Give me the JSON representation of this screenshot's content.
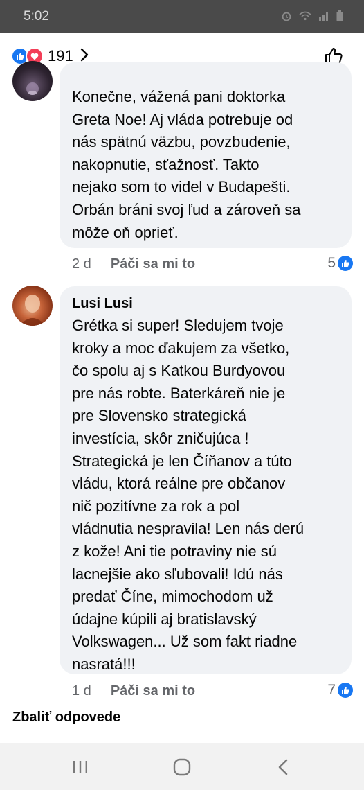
{
  "status_bar": {
    "time": "5:02"
  },
  "header": {
    "reaction_count": "191",
    "icons": [
      "like-reaction-icon",
      "love-reaction-icon",
      "chevron-right-icon",
      "thumbs-up-icon"
    ]
  },
  "comments": [
    {
      "author": "",
      "text": "Konečne, vážená pani doktorka\nGreta Noe! Aj vláda potrebuje od\nnás spätnú väzbu, povzbudenie,\nnakopnutie, sťažnosť. Takto\nnejako som to videl v Budapešti.\nOrbán bráni svoj ľud a zároveň sa\nmôže oň oprieť.",
      "age": "2 d",
      "like_label": "Páči sa mi to",
      "like_count": "5"
    },
    {
      "author": "Lusi Lusi",
      "text": "Grétka si super! Sledujem tvoje\nkroky a moc ďakujem za všetko,\nčo spolu aj s Katkou Burdyovou\npre nás robte. Baterkáreň nie je\npre Slovensko strategická\ninvestícia, skôr zničujúca !\nStrategická  je len Číňanov a túto\nvládu, ktorá reálne pre občanov\nnič pozitívne za rok a pol\nvládnutia nespravila! Len nás derú\nz kože! Ani tie potraviny nie sú\nlacnejšie ako sľubovali! Idú nás\npredať Číne, mimochodom už\núdajne kúpili aj bratislavský\nVolkswagen... Už som fakt riadne\nnasratá!!!",
      "age": "1 d",
      "like_label": "Páči sa mi to",
      "like_count": "7"
    }
  ],
  "collapse_label": "Zbaliť odpovede",
  "colors": {
    "facebook_blue": "#1877f2",
    "love_red": "#f33e58",
    "bubble_gray": "#f0f2f5",
    "meta_gray": "#65676b"
  }
}
